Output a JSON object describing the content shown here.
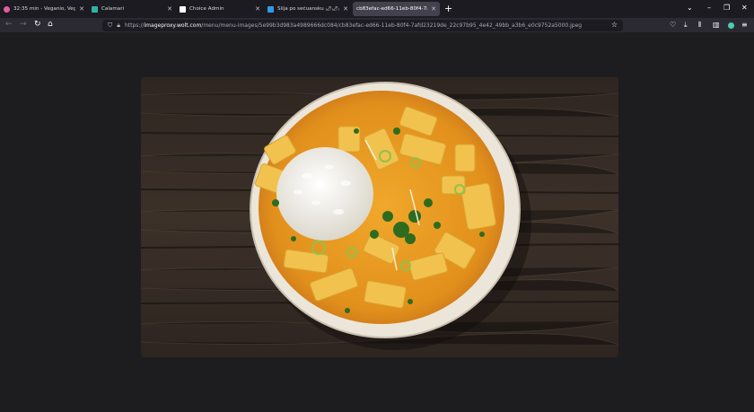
{
  "tabs": [
    {
      "title": "32:35 min - Veganio, Veganio -",
      "favicon_color": "#e75d9b",
      "active": false
    },
    {
      "title": "Calamari",
      "favicon_color": "#2fb3a0",
      "active": false
    },
    {
      "title": "Choice Admin",
      "favicon_color": "#ffffff",
      "active": false
    },
    {
      "title": "Silja po sečuansku 🌶🌶🌶 (1",
      "favicon_color": "#2f9be8",
      "active": false
    },
    {
      "title": "cb83efac-ed66-11eb-80f4-7afd23",
      "favicon_color": "",
      "active": true
    }
  ],
  "toolbar": {
    "back_icon": "arrow-left-icon",
    "forward_icon": "arrow-right-icon",
    "reload_icon": "reload-icon",
    "home_icon": "home-icon"
  },
  "urlbar": {
    "scheme": "https://",
    "host": "imageproxy.wolt.com",
    "path": "/menu/menu-images/5e99b3d983a4989666dc084/cb83efac-ed66-11eb-80f4-7afd23219de_22c97b95_4e42_49bb_a3b6_e0c9752a5000.jpeg"
  },
  "image": {
    "alt": "vegetable curry with tofu and rice in a bowl",
    "colors": {
      "wood": "#3b3028",
      "curry": "#e59a1f",
      "rice": "#f3f1ea",
      "herbs": "#2f6b1f"
    }
  }
}
